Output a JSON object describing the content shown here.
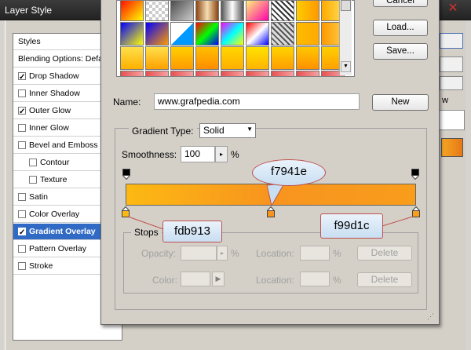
{
  "background_window": {
    "title": "Layer Style",
    "styles_panel": {
      "header": "Styles",
      "blending": "Blending Options: Default",
      "items": [
        {
          "label": "Drop Shadow",
          "checked": true,
          "indent": false
        },
        {
          "label": "Inner Shadow",
          "checked": false,
          "indent": false
        },
        {
          "label": "Outer Glow",
          "checked": true,
          "indent": false
        },
        {
          "label": "Inner Glow",
          "checked": false,
          "indent": false
        },
        {
          "label": "Bevel and Emboss",
          "checked": false,
          "indent": false
        },
        {
          "label": "Contour",
          "checked": false,
          "indent": true
        },
        {
          "label": "Texture",
          "checked": false,
          "indent": true
        },
        {
          "label": "Satin",
          "checked": false,
          "indent": false
        },
        {
          "label": "Color Overlay",
          "checked": false,
          "indent": false
        },
        {
          "label": "Gradient Overlay",
          "checked": true,
          "indent": false,
          "selected": true
        },
        {
          "label": "Pattern Overlay",
          "checked": false,
          "indent": false
        },
        {
          "label": "Stroke",
          "checked": false,
          "indent": false
        }
      ]
    },
    "preview_label": "w"
  },
  "gradient_editor": {
    "buttons": {
      "cancel": "Cancel",
      "load": "Load...",
      "save": "Save...",
      "new": "New"
    },
    "name": {
      "label": "Name:",
      "value": "www.grafpedia.com"
    },
    "gradient_type": {
      "label": "Gradient Type:",
      "value": "Solid"
    },
    "smoothness": {
      "label": "Smoothness:",
      "value": "100",
      "unit": "%"
    },
    "gradient": {
      "stops": [
        {
          "position": 0.0,
          "color": "#fdb913"
        },
        {
          "position": 0.5,
          "color": "#f7941e"
        },
        {
          "position": 1.0,
          "color": "#f99d1c"
        }
      ]
    },
    "stops_group": {
      "legend": "Stops",
      "opacity_label": "Opacity:",
      "opacity_unit": "%",
      "color_label": "Color:",
      "location_label": "Location:",
      "location_unit": "%",
      "delete_label": "Delete"
    }
  },
  "annotations": {
    "middle": "f7941e",
    "left": "fdb913",
    "right": "f99d1c"
  },
  "colors": {
    "accent_selection": "#316ac5",
    "annotation_border": "#c0504d"
  }
}
